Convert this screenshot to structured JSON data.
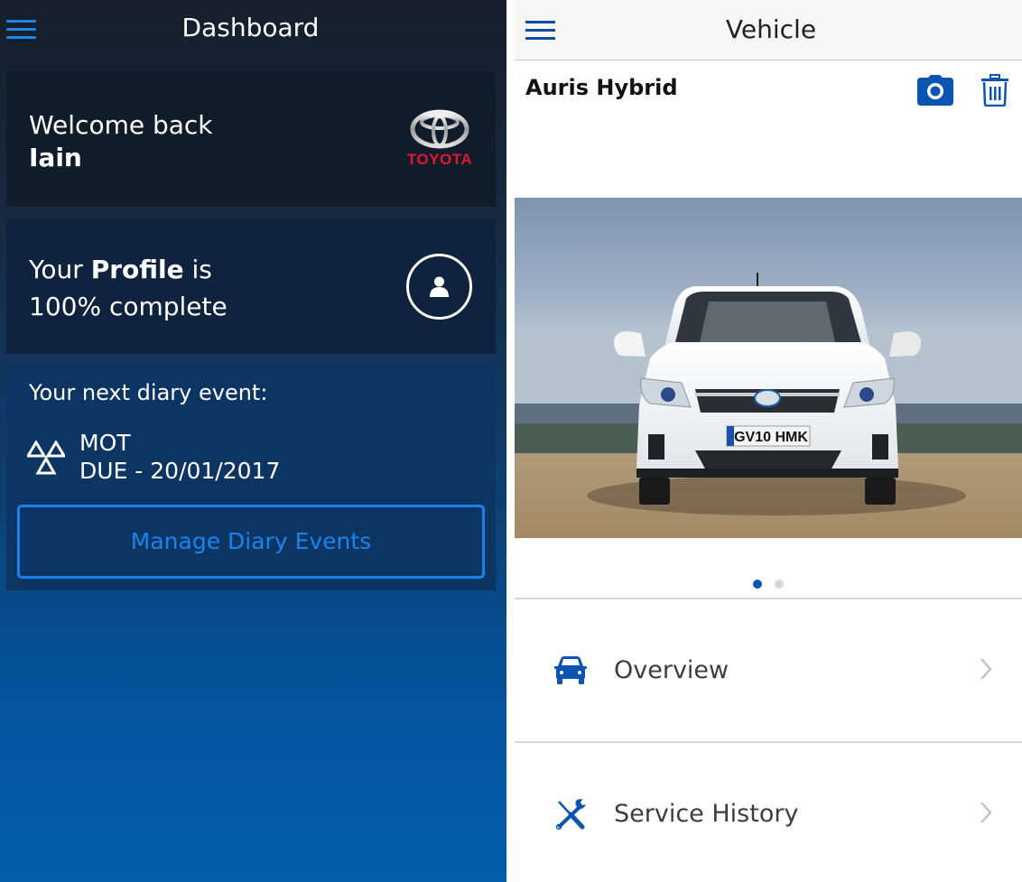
{
  "dashboard": {
    "title": "Dashboard",
    "menu_icon": "hamburger-menu-icon",
    "welcome": {
      "greeting": "Welcome back",
      "name": "Iain",
      "brand": "TOYOTA",
      "brand_color": "#e3182d"
    },
    "profile": {
      "prefix": "Your ",
      "emphasis": "Profile",
      "suffix": " is",
      "completion_line": "100% complete",
      "completion_percent": 100,
      "icon": "user-icon"
    },
    "diary": {
      "heading": "Your next diary event:",
      "event_icon": "mot-triangles-icon",
      "event_name": "MOT",
      "event_due": "DUE - 20/01/2017",
      "manage_button": "Manage Diary Events"
    },
    "colors": {
      "accent": "#1a84ee",
      "card_bg": "#111c2b",
      "gradient_bottom": "#035eae"
    }
  },
  "vehicle": {
    "title": "Vehicle",
    "menu_icon": "hamburger-menu-icon",
    "name": "Auris Hybrid",
    "actions": [
      {
        "icon": "camera-icon",
        "label": "Add photo"
      },
      {
        "icon": "trash-icon",
        "label": "Delete vehicle"
      }
    ],
    "photo": {
      "plate": "GV10 HMK",
      "page_count": 2,
      "current_page": 1
    },
    "menu": [
      {
        "label": "Overview",
        "icon": "car-icon"
      },
      {
        "label": "Service History",
        "icon": "tools-icon"
      }
    ],
    "colors": {
      "accent": "#0a55b1",
      "text": "#3b3d42"
    }
  }
}
